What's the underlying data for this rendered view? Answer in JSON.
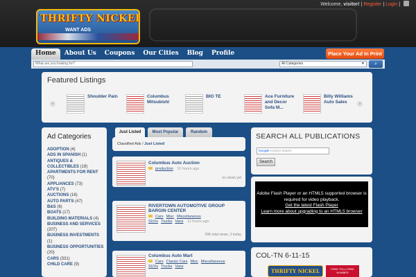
{
  "header": {
    "welcome_prefix": "Welcome,",
    "user": "visitor!",
    "register": "Register",
    "login": "Login",
    "logo_line1": "THRIFTY NICKEL",
    "logo_line2": "WANT ADS"
  },
  "nav": {
    "items": [
      {
        "label": "Home",
        "active": true
      },
      {
        "label": "About Us"
      },
      {
        "label": "Coupons"
      },
      {
        "label": "Our Cities"
      },
      {
        "label": "Blog"
      },
      {
        "label": "Profile"
      }
    ],
    "place_ad": "Place Your Ad In Print"
  },
  "search": {
    "placeholder": "What are you looking for?",
    "category": "All Categories",
    "button_icon": "search-icon"
  },
  "featured": {
    "title": "Featured Listings",
    "items": [
      {
        "label": "Shoulder Pain"
      },
      {
        "label": "Columbus Mitsubishi"
      },
      {
        "label": "BIO TE"
      },
      {
        "label": "Ace Furniture and Decor Sofa M..."
      },
      {
        "label": "Billy Williams Auto Sales"
      }
    ]
  },
  "categories": {
    "title": "Ad Categories",
    "items": [
      {
        "name": "ADOPTION",
        "count": "(4)"
      },
      {
        "name": "ADS IN SPANISH",
        "count": "(1)"
      },
      {
        "name": "ANTIQUES & COLLECTIBLES",
        "count": "(19)"
      },
      {
        "name": "APARTMENTS FOR RENT",
        "count": "(70)"
      },
      {
        "name": "APPLIANCES",
        "count": "(73)"
      },
      {
        "name": "ATV'S",
        "count": "(7)"
      },
      {
        "name": "AUCTIONS",
        "count": "(16)"
      },
      {
        "name": "AUTO PARTS",
        "count": "(47)"
      },
      {
        "name": "B&S",
        "count": "(6)"
      },
      {
        "name": "BOATS",
        "count": "(17)"
      },
      {
        "name": "BUILDING MATERIALS",
        "count": "(4)"
      },
      {
        "name": "BUSINESS AND SERVICES",
        "count": "(207)"
      },
      {
        "name": "BUSINESS INVESTMENTS",
        "count": "(1)"
      },
      {
        "name": "BUSINESS OPPORTUNITIES",
        "count": "(20)"
      },
      {
        "name": "CARS",
        "count": "(331)"
      },
      {
        "name": "CHILD CARE",
        "count": "(9)"
      }
    ]
  },
  "tabs": [
    "Just Listed",
    "Most Popular",
    "Random"
  ],
  "breadcrumb": {
    "root": "Classified Ads",
    "sep": " / ",
    "current": "Just Listed"
  },
  "listings": [
    {
      "title": "Columbus Auto Auction",
      "cats": [
        "production"
      ],
      "time": "10 hours ago",
      "stats": "no views yet"
    },
    {
      "title": "RIVERTOWN AUTOMOTIVE GROUP BARGIN CENTER",
      "cats": [
        "Cars",
        "Misc",
        "Miscellaneous",
        "SUVs",
        "Trucks",
        "Vans"
      ],
      "time": "11 hours ago",
      "stats": "596 total views, 3 today"
    },
    {
      "title": "Columbus Auto Mart",
      "cats": [
        "Cars",
        "Classic Cars",
        "Misc",
        "Miscellaneous",
        "SUVs",
        "Trucks",
        "Vans"
      ],
      "time": "",
      "stats": ""
    }
  ],
  "sidebar": {
    "search_title": "SEARCH ALL PUBLICATIONS",
    "google_label": "Google",
    "google_placeholder": "Custom Search",
    "search_button": "Search",
    "video_line1": "Adobe Flash Player or an HTML5 supported browser is required for video playback.",
    "video_link1": "Get the latest Flash Player",
    "video_link2": "Learn more about upgrading to an HTML5 browser",
    "edition_title": "COL-TN 6-11-15",
    "edition_logo": "THRIFTY NICKEL",
    "edition_red": "FREE TOLL-FREE NUMBER"
  },
  "colors": {
    "accent": "#ff5b3a",
    "link": "#2a4f80",
    "background": "#1c4f86"
  }
}
